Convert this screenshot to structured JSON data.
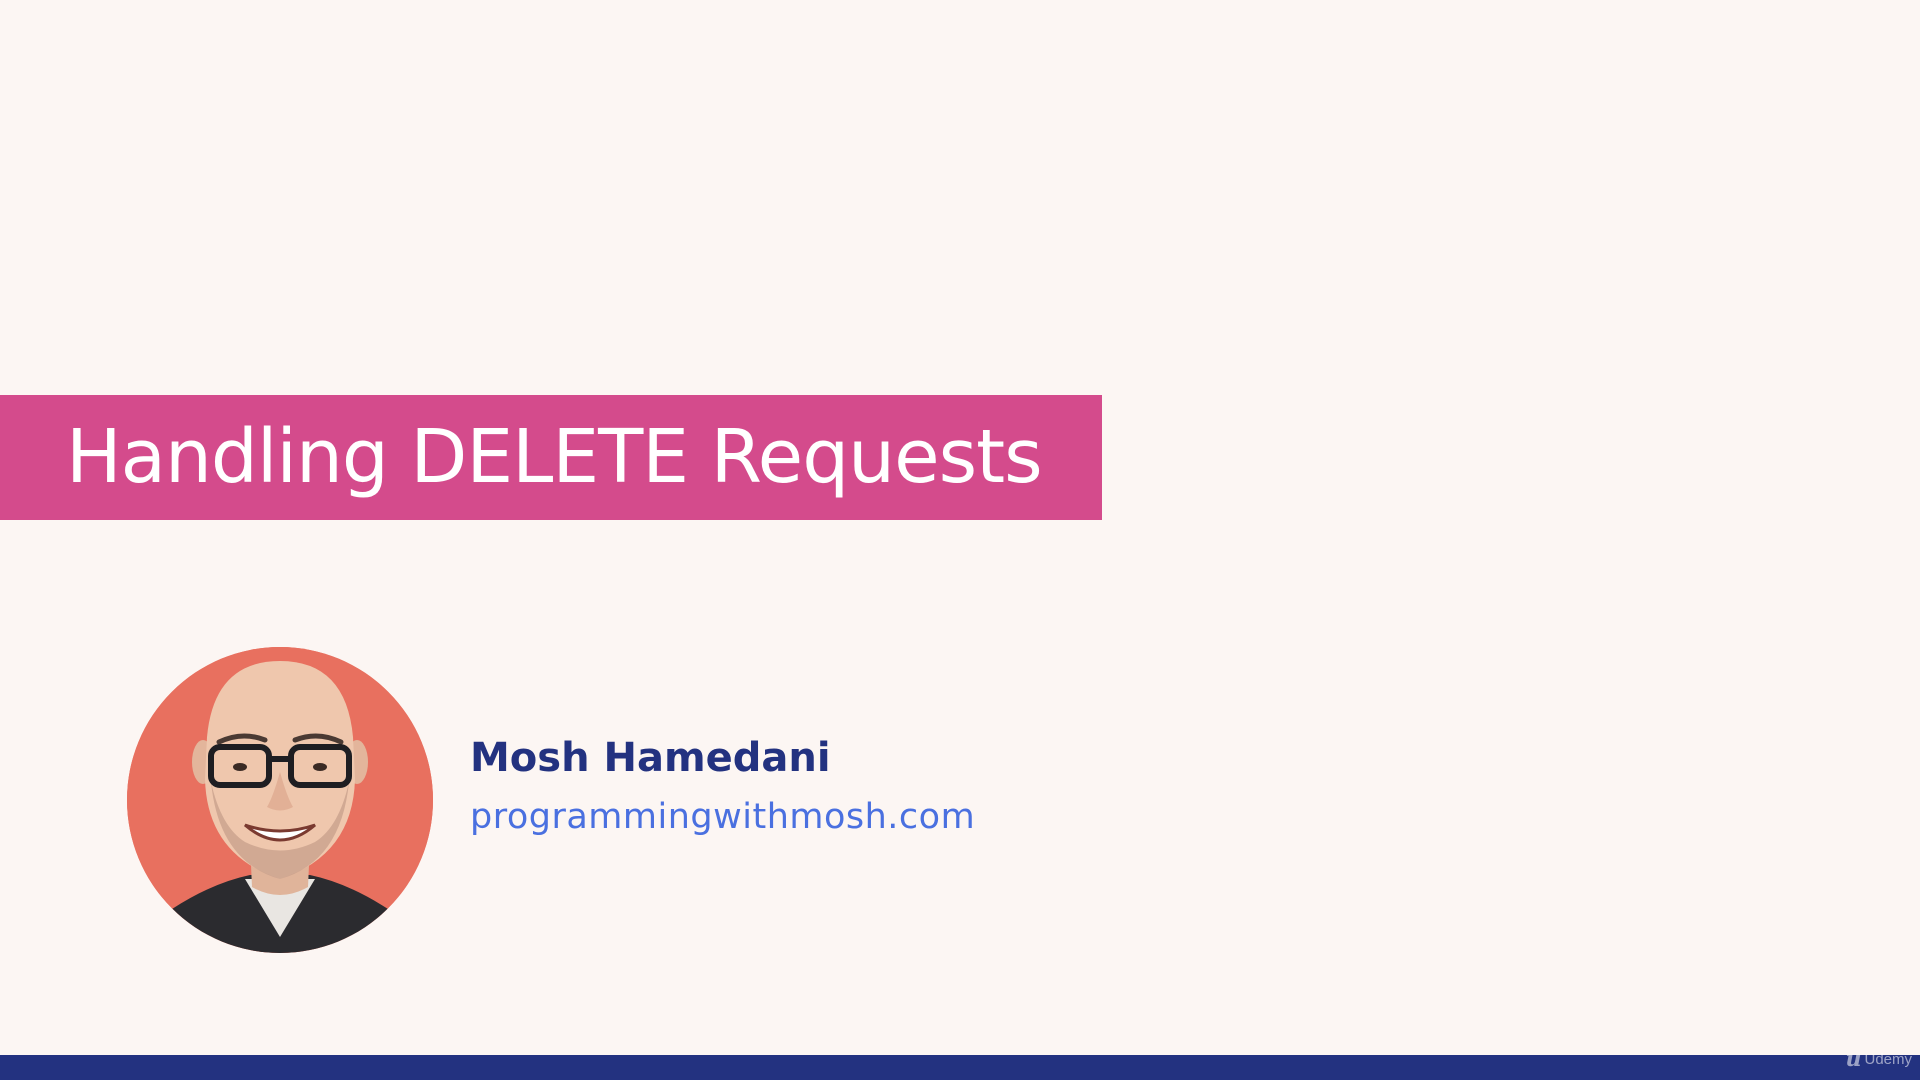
{
  "title": "Handling DELETE Requests",
  "author": {
    "name": "Mosh Hamedani",
    "website": "programmingwithmosh.com",
    "avatar_icon": "person-portrait"
  },
  "watermark": {
    "logo_icon": "udemy-logo",
    "text": "Udemy"
  },
  "colors": {
    "background": "#fcf6f3",
    "banner": "#d44b8c",
    "title_text": "#ffffff",
    "author_name": "#233280",
    "author_site": "#4a70e0",
    "bottom_bar": "#233280",
    "avatar_background": "#e8705f"
  }
}
